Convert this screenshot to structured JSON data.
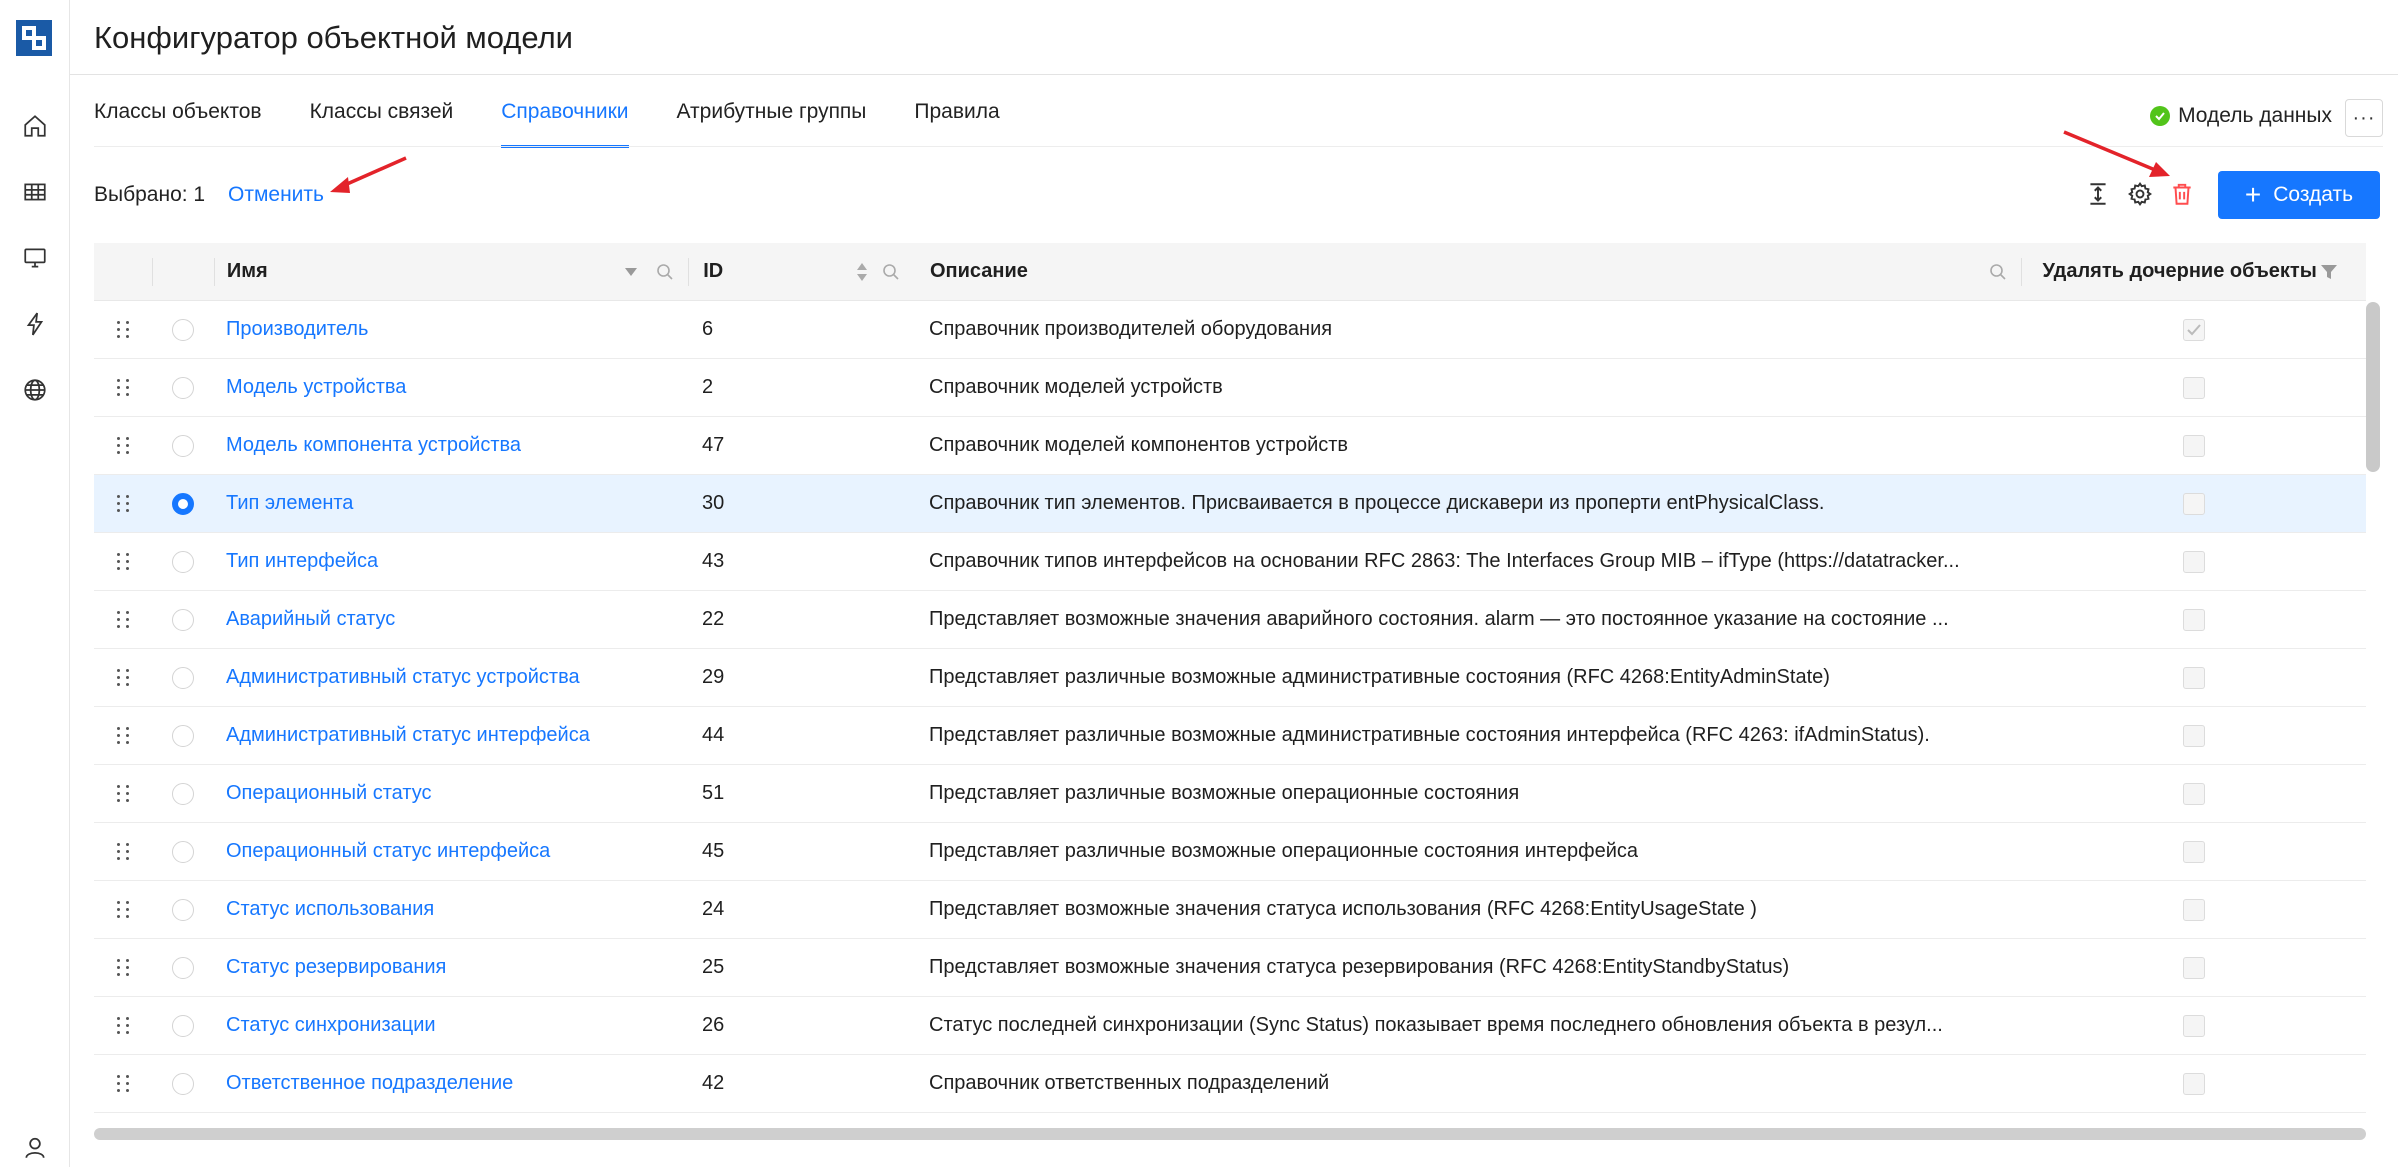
{
  "app": {
    "title": "Конфигуратор объектной модели"
  },
  "sidebar": {
    "items": [
      {
        "icon": "home-icon"
      },
      {
        "icon": "table-icon"
      },
      {
        "icon": "monitor-icon"
      },
      {
        "icon": "lightning-icon"
      },
      {
        "icon": "globe-icon"
      }
    ],
    "bottom_icon": "user-icon"
  },
  "tabs": [
    {
      "label": "Классы объектов",
      "active": false
    },
    {
      "label": "Классы связей",
      "active": false
    },
    {
      "label": "Справочники",
      "active": true
    },
    {
      "label": "Атрибутные группы",
      "active": false
    },
    {
      "label": "Правила",
      "active": false
    }
  ],
  "model_status": {
    "label": "Модель данных",
    "color": "#52c41a"
  },
  "more_button": {
    "label": "···"
  },
  "selection": {
    "label": "Выбрано: 1",
    "cancel_label": "Отменить"
  },
  "toolbar": {
    "create_label": "Создать",
    "accent": "#1677ff",
    "danger": "#ff4d4f"
  },
  "table": {
    "columns": {
      "name": "Имя",
      "id": "ID",
      "description": "Описание",
      "delete_children": "Удалять дочерние объекты"
    },
    "rows": [
      {
        "name": "Производитель",
        "id": "6",
        "description": "Справочник производителей оборудования",
        "selected": false,
        "delete_children": true
      },
      {
        "name": "Модель устройства",
        "id": "2",
        "description": "Справочник моделей устройств",
        "selected": false,
        "delete_children": false
      },
      {
        "name": "Модель компонента устройства",
        "id": "47",
        "description": "Справочник моделей компонентов устройств",
        "selected": false,
        "delete_children": false
      },
      {
        "name": "Тип элемента",
        "id": "30",
        "description": "Справочник тип элементов. Присваивается в процессе дискавери из проперти entPhysicalClass.",
        "selected": true,
        "delete_children": false
      },
      {
        "name": "Тип интерфейса",
        "id": "43",
        "description": "Справочник типов интерфейсов на основании RFC 2863: The Interfaces Group MIB – ifType (https://datatracker...",
        "selected": false,
        "delete_children": false
      },
      {
        "name": "Аварийный статус",
        "id": "22",
        "description": "Представляет возможные значения аварийного состояния. alarm — это постоянное указание на состояние ...",
        "selected": false,
        "delete_children": false
      },
      {
        "name": "Административный статус устройства",
        "id": "29",
        "description": "Представляет различные возможные административные состояния (RFC 4268:EntityAdminState)",
        "selected": false,
        "delete_children": false
      },
      {
        "name": "Административный статус интерфейса",
        "id": "44",
        "description": "Представляет различные возможные административные состояния интерфейса (RFC 4263: ifAdminStatus).",
        "selected": false,
        "delete_children": false
      },
      {
        "name": "Операционный статус",
        "id": "51",
        "description": "Представляет различные возможные операционные состояния",
        "selected": false,
        "delete_children": false
      },
      {
        "name": "Операционный статус интерфейса",
        "id": "45",
        "description": "Представляет различные возможные операционные состояния интерфейса",
        "selected": false,
        "delete_children": false
      },
      {
        "name": "Статус использования",
        "id": "24",
        "description": "Представляет возможные значения статуса использования (RFC 4268:EntityUsageState )",
        "selected": false,
        "delete_children": false
      },
      {
        "name": "Статус резервирования",
        "id": "25",
        "description": "Представляет возможные значения статуса резервирования (RFC 4268:EntityStandbyStatus)",
        "selected": false,
        "delete_children": false
      },
      {
        "name": "Статус синхронизации",
        "id": "26",
        "description": "Статус последней синхронизации (Sync Status) показывает время последнего обновления объекта в резул...",
        "selected": false,
        "delete_children": false
      },
      {
        "name": "Ответственное подразделение",
        "id": "42",
        "description": "Справочник ответственных подразделений",
        "selected": false,
        "delete_children": false
      }
    ]
  }
}
